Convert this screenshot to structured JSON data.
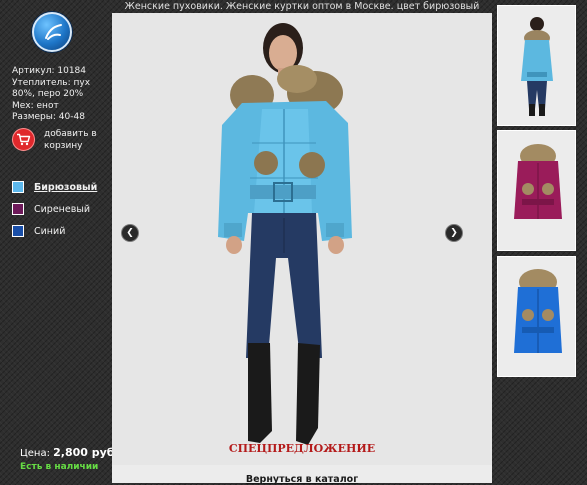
{
  "page_title": "Женские пуховики. Женские куртки оптом в Москве. цвет бирюзовый",
  "specs": [
    "Артикул: 10184",
    "Утеплитель: пух 80%, перо 20%",
    "Мех: енот",
    "Размеры: 40-48"
  ],
  "cart": {
    "label": "добавить в корзину",
    "icon": "cart-icon"
  },
  "colors": [
    {
      "label": "Бирюзовый",
      "hex": "#5cb8ec",
      "active": true
    },
    {
      "label": "Сиреневый",
      "hex": "#6e1a5a",
      "active": false
    },
    {
      "label": "Синий",
      "hex": "#1a4fa8",
      "active": false
    }
  ],
  "price": {
    "label": "Цена:",
    "value": "2,800 руб."
  },
  "stock": "Есть в наличии",
  "special": "СПЕЦПРЕДЛОЖЕНИЕ",
  "back_link": "Вернуться в каталог",
  "thumbnails": [
    {
      "color": "#5cb8ec"
    },
    {
      "color": "#9a1c5a"
    },
    {
      "color": "#1f6fd6"
    }
  ],
  "accent_colors": {
    "special": "#b41a1a",
    "stock": "#66dd44"
  }
}
